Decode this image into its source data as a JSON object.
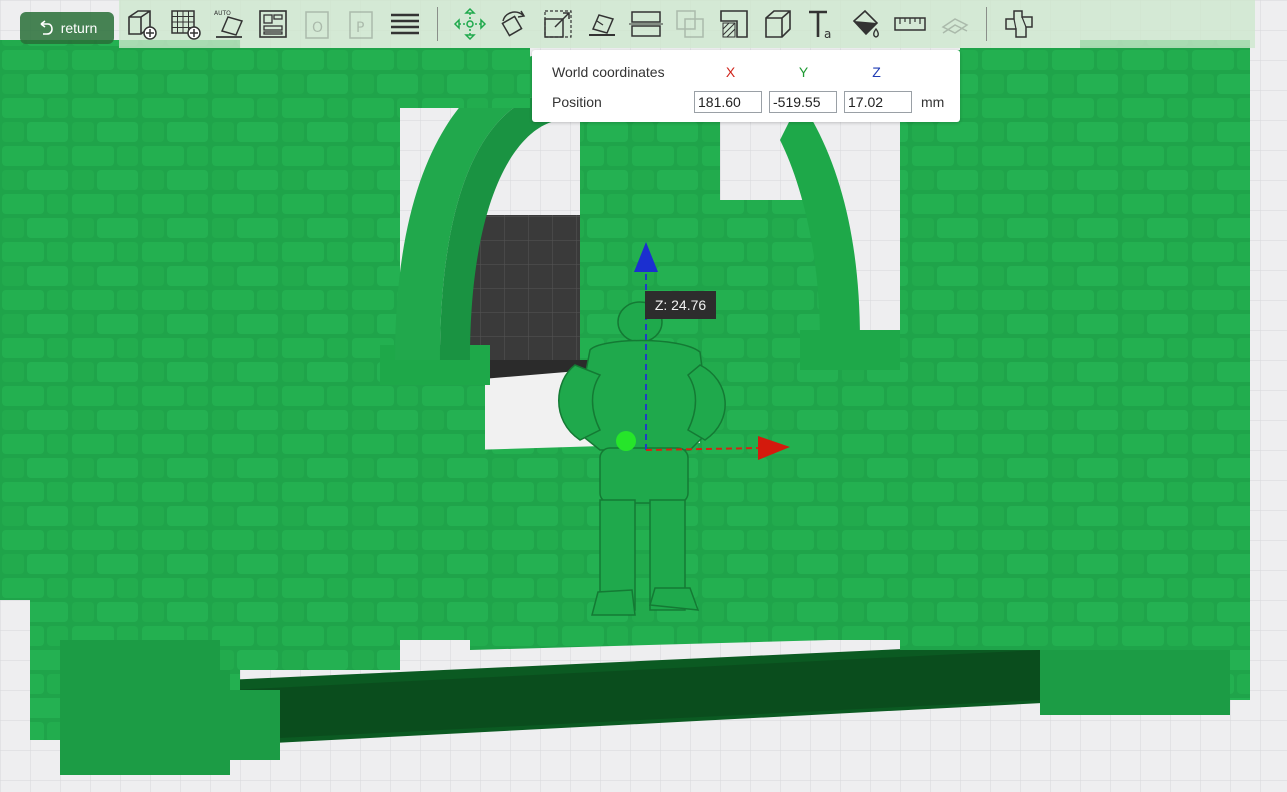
{
  "header": {
    "return_label": "return"
  },
  "toolbar": {
    "tools": [
      {
        "name": "add-model-icon"
      },
      {
        "name": "add-plate-icon"
      },
      {
        "name": "auto-orient-icon",
        "badge": "AUTO"
      },
      {
        "name": "arrange-icon"
      },
      {
        "name": "split-objects-icon"
      },
      {
        "name": "split-parts-icon"
      },
      {
        "name": "layers-icon"
      },
      {
        "name": "move-icon"
      },
      {
        "name": "rotate-icon"
      },
      {
        "name": "scale-icon"
      },
      {
        "name": "lay-on-face-icon"
      },
      {
        "name": "cut-icon"
      },
      {
        "name": "boolean-icon"
      },
      {
        "name": "support-paint-icon"
      },
      {
        "name": "seam-paint-icon"
      },
      {
        "name": "text-icon",
        "badge": "T",
        "sub": "a"
      },
      {
        "name": "color-paint-icon"
      },
      {
        "name": "measure-icon"
      },
      {
        "name": "assembly-icon"
      },
      {
        "name": "simplify-icon"
      }
    ]
  },
  "coordinates": {
    "title": "World coordinates",
    "x_label": "X",
    "y_label": "Y",
    "z_label": "Z",
    "position_label": "Position",
    "x_value": "181.60",
    "y_value": "-519.55",
    "z_value": "17.02",
    "unit": "mm",
    "colors": {
      "x": "#d0241b",
      "y": "#1e9a33",
      "z": "#1f3bb4"
    }
  },
  "gizmo": {
    "tooltip": "Z: 24.76"
  },
  "colors": {
    "model": "#1fa64a",
    "model_dark": "#0f7a30",
    "bed": "#ececee",
    "toolbar": "#cde8cd"
  }
}
